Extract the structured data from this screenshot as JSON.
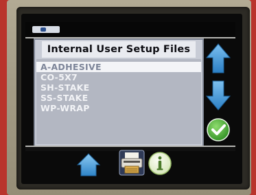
{
  "panel": {
    "title": "Internal User Setup Files",
    "files": [
      {
        "label": "A-ADHESIVE",
        "selected": true
      },
      {
        "label": "CO-5X7",
        "selected": false
      },
      {
        "label": "SH-STAKE",
        "selected": false
      },
      {
        "label": "SS-STAKE",
        "selected": false
      },
      {
        "label": "WP-WRAP",
        "selected": false
      }
    ]
  },
  "side_buttons": {
    "up_icon": "arrow-up-icon",
    "down_icon": "arrow-down-icon",
    "ok_icon": "checkmark-icon"
  },
  "bottom_buttons": {
    "home_icon": "home-icon",
    "print_icon": "printer-icon",
    "info_icon": "info-icon"
  },
  "colors": {
    "accent_blue": "#3d93d6",
    "ok_green": "#43a934",
    "device_red": "#b9342c"
  }
}
